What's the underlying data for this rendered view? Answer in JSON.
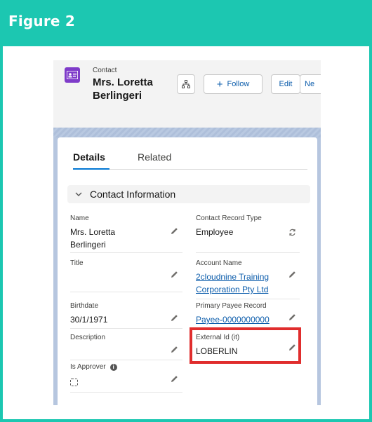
{
  "figure": {
    "title": "Figure 2",
    "accent_color": "#1cc7b1"
  },
  "record": {
    "object_type": "Contact",
    "name_line1": "Mrs. Loretta",
    "name_line2": "Berlingeri",
    "icon": "contact-card-icon"
  },
  "actions": {
    "hierarchy_icon": "hierarchy-icon",
    "follow_label": "Follow",
    "edit_label": "Edit",
    "new_label": "Ne"
  },
  "tabs": [
    {
      "label": "Details",
      "active": true
    },
    {
      "label": "Related",
      "active": false
    }
  ],
  "section": {
    "title": "Contact Information",
    "expanded": true
  },
  "fields": {
    "name": {
      "label": "Name",
      "line1": "Mrs. Loretta",
      "line2": "Berlingeri"
    },
    "contact_record_type": {
      "label": "Contact Record Type",
      "value": "Employee"
    },
    "title": {
      "label": "Title",
      "value": ""
    },
    "account_name": {
      "label": "Account Name",
      "line1": "2cloudnine Training",
      "line2": "Corporation Pty Ltd"
    },
    "birthdate": {
      "label": "Birthdate",
      "value": "30/1/1971"
    },
    "primary_payee_record": {
      "label": "Primary Payee Record",
      "value": "Payee-0000000000"
    },
    "description": {
      "label": "Description",
      "value": ""
    },
    "external_id": {
      "label": "External Id (it)",
      "value": "LOBERLIN"
    },
    "is_approver": {
      "label": "Is Approver",
      "value": false
    }
  },
  "highlight_color": "#e02d2d"
}
